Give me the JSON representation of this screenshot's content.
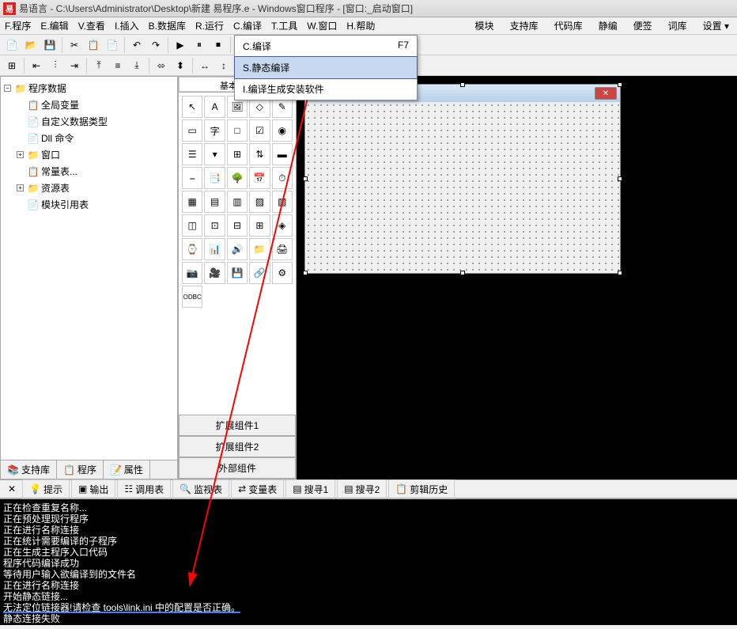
{
  "titlebar": {
    "text": "易语言 - C:\\Users\\Administrator\\Desktop\\新建 易程序.e - Windows窗口程序 - [窗口:_启动窗口]"
  },
  "menubar": {
    "left": [
      "F.程序",
      "E.编辑",
      "V.查看",
      "I.插入",
      "B.数据库",
      "R.运行",
      "C.编译",
      "T.工具",
      "W.窗口",
      "H.帮助"
    ],
    "right": [
      "模块",
      "支持库",
      "代码库",
      "静编",
      "便签",
      "词库",
      "设置 ▾"
    ]
  },
  "dropdown": {
    "items": [
      {
        "label": "C.编译",
        "shortcut": "F7"
      },
      {
        "label": "S.静态编译",
        "shortcut": ""
      },
      {
        "label": "I.编译生成安装软件",
        "shortcut": ""
      }
    ],
    "selected": 1
  },
  "tree": {
    "root": "程序数据",
    "items": [
      {
        "icon": "📋",
        "label": "全局变量",
        "indent": 1
      },
      {
        "icon": "📄",
        "label": "自定义数据类型",
        "indent": 1
      },
      {
        "icon": "📄",
        "label": "Dll 命令",
        "indent": 1
      },
      {
        "icon": "📁",
        "label": "窗口",
        "indent": 1,
        "box": "+"
      },
      {
        "icon": "📋",
        "label": "常量表...",
        "indent": 1
      },
      {
        "icon": "📁",
        "label": "资源表",
        "indent": 1,
        "box": "+"
      },
      {
        "icon": "📄",
        "label": "模块引用表",
        "indent": 1
      }
    ]
  },
  "left_tabs": [
    "支持库",
    "程序",
    "属性"
  ],
  "palette": {
    "top_tab": "基本组件",
    "bottom_tabs": [
      "扩展组件1",
      "扩展组件2",
      "外部组件"
    ]
  },
  "bottom_tabs": {
    "items": [
      "提示",
      "输出",
      "调用表",
      "监视表",
      "变量表",
      "搜寻1",
      "搜寻2",
      "剪辑历史"
    ]
  },
  "output": {
    "lines": [
      "正在检查重复名称...",
      "正在预处理现行程序",
      "正在进行名称连接",
      "正在统计需要编译的子程序",
      "正在生成主程序入口代码",
      "程序代码编译成功",
      "等待用户输入欲编译到的文件名",
      "正在进行名称连接",
      "开始静态链接..."
    ],
    "highlight": "无法定位链接器!请检查 tools\\link.ini 中的配置是否正确。",
    "last": "静态连接失败"
  }
}
